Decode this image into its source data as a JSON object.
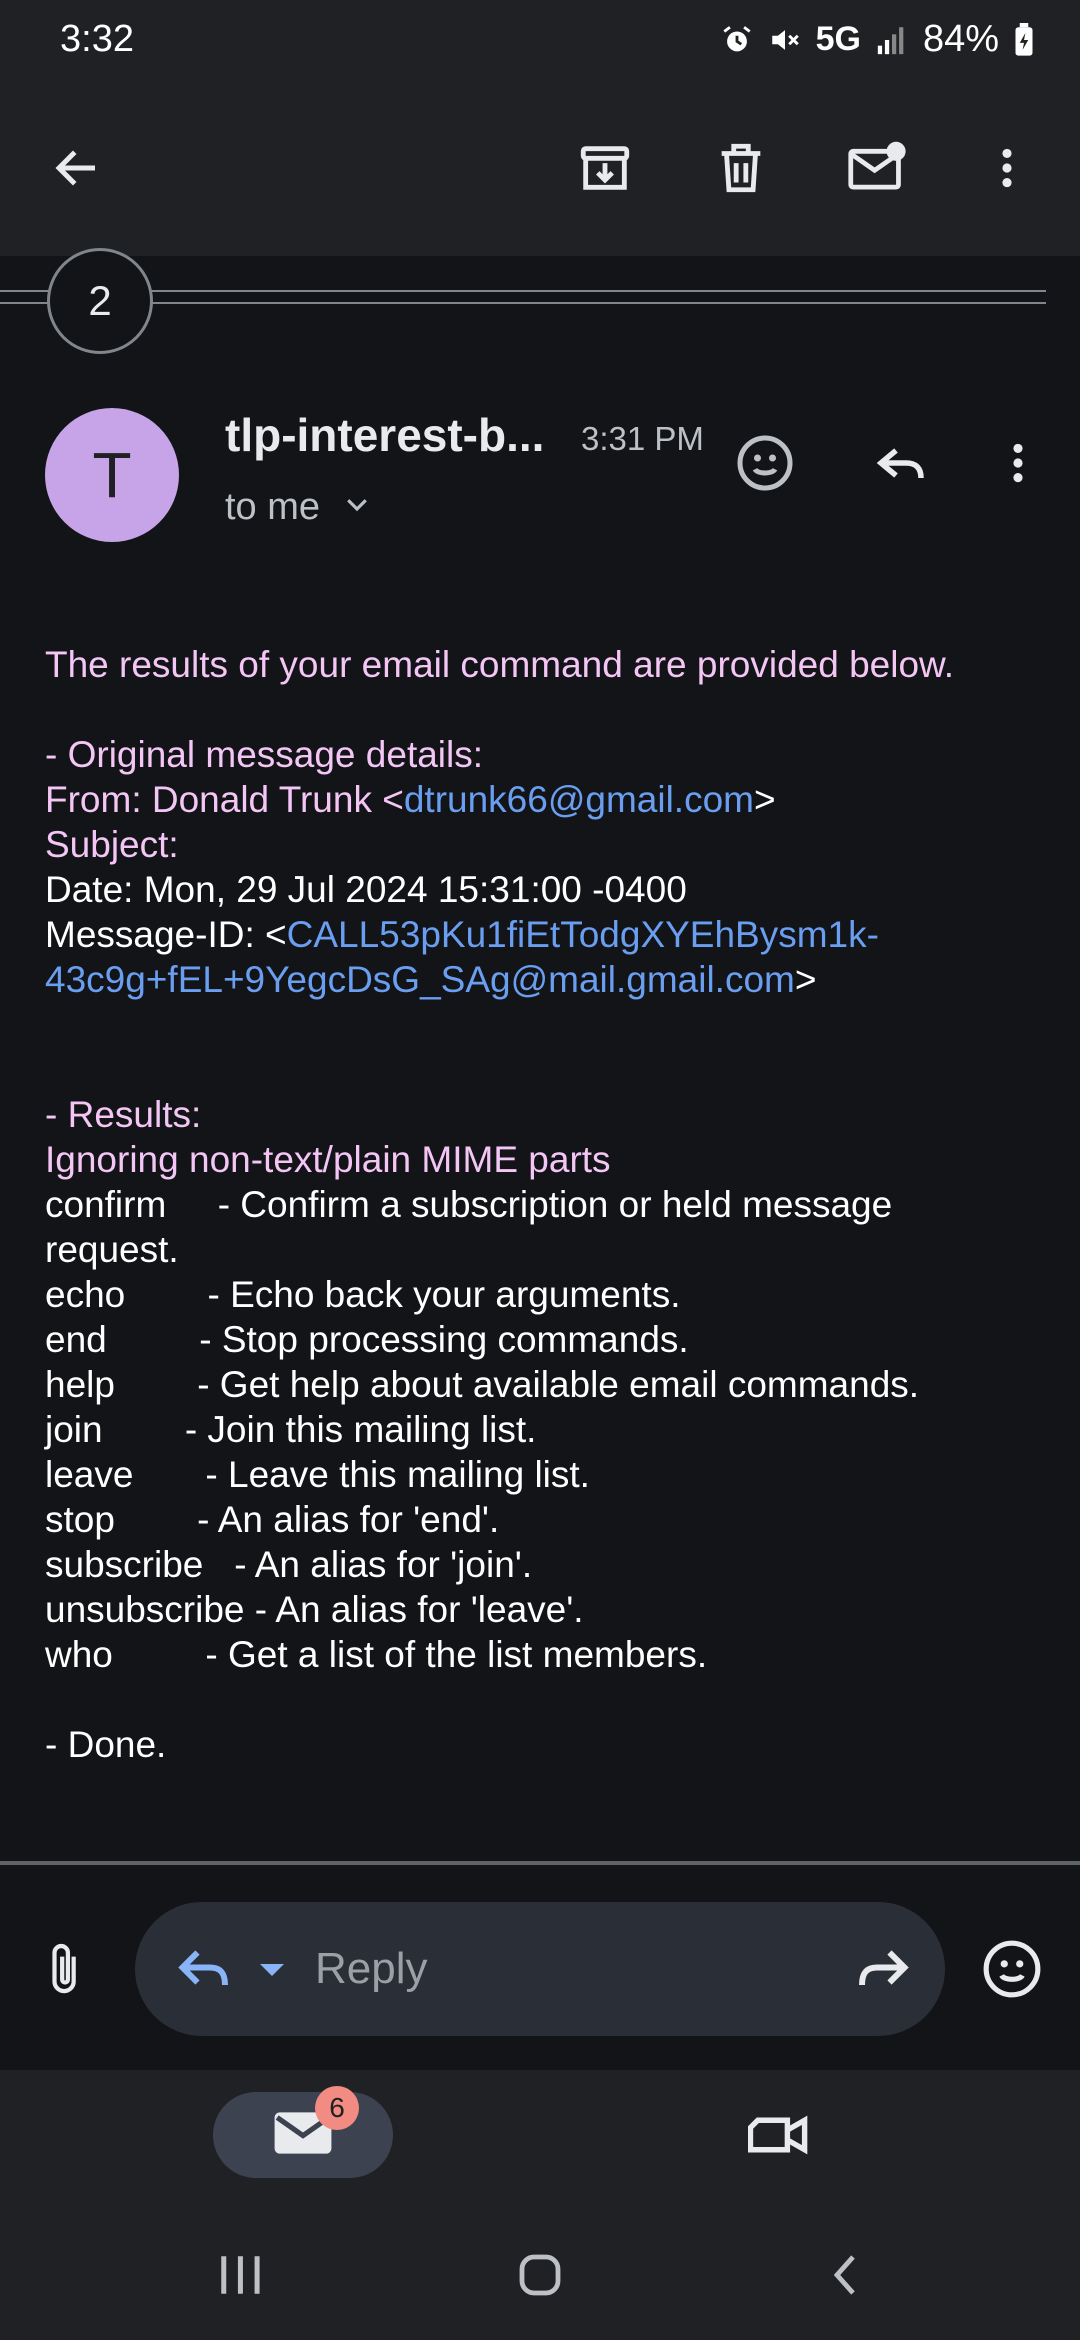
{
  "status_bar": {
    "time": "3:32",
    "network": "5G",
    "battery": "84%",
    "icons": [
      "alarm-icon",
      "mute-icon",
      "signal-icon",
      "battery-icon"
    ]
  },
  "toolbar": {
    "icons": [
      "back-arrow-icon",
      "archive-icon",
      "trash-icon",
      "mark-unread-icon",
      "more-vert-icon"
    ]
  },
  "thread": {
    "collapsed_count": "2"
  },
  "message": {
    "avatar_letter": "T",
    "avatar_color": "#c6a4e7",
    "sender": "tlp-interest-b...",
    "time": "3:31 PM",
    "recipient": "to me",
    "header_icons": [
      "emoji-react-icon",
      "reply-icon",
      "more-vert-icon"
    ]
  },
  "body": {
    "intro": "The results of your email command are provided below.",
    "orig_heading": "- Original message details:",
    "from_label": "From: Donald Trunk <",
    "from_email": "dtrunk66@gmail.com",
    "from_close": ">",
    "subject": "Subject:",
    "date": "Date: Mon, 29 Jul 2024 15:31:00 -0400",
    "msgid_label": "Message-ID: <",
    "msgid_part1": "CALL53pKu1fiEtTodgXYEhBysm1k-",
    "msgid_part2": "43c9g+fEL+9YegcDsG_SAg@mail.gmail.com",
    "msgid_close": ">",
    "results_heading": "- Results:",
    "ignoring": "Ignoring non-text/plain MIME parts",
    "commands": [
      "confirm     - Confirm a subscription or held message",
      "request.",
      "echo        - Echo back your arguments.",
      "end         - Stop processing commands.",
      "help        - Get help about available email commands.",
      "join        - Join this mailing list.",
      "leave       - Leave this mailing list.",
      "stop        - An alias for 'end'.",
      "subscribe   - An alias for 'join'.",
      "unsubscribe - An alias for 'leave'.",
      "who         - Get a list of the list members."
    ],
    "done": "- Done."
  },
  "reply_bar": {
    "placeholder": "Reply",
    "icons": [
      "attachment-icon",
      "reply-icon",
      "dropdown-icon",
      "forward-icon",
      "emoji-icon"
    ]
  },
  "bottom_nav": {
    "mail_badge": "6",
    "icons": [
      "mail-icon",
      "video-meet-icon"
    ]
  },
  "system_nav": {
    "icons": [
      "recents-icon",
      "home-icon",
      "back-icon"
    ]
  },
  "colors": {
    "background": "#131418",
    "bar": "#202124",
    "accent_pink": "#f4c6f5",
    "link_blue": "#6a9ef0",
    "badge": "#f28b82"
  }
}
